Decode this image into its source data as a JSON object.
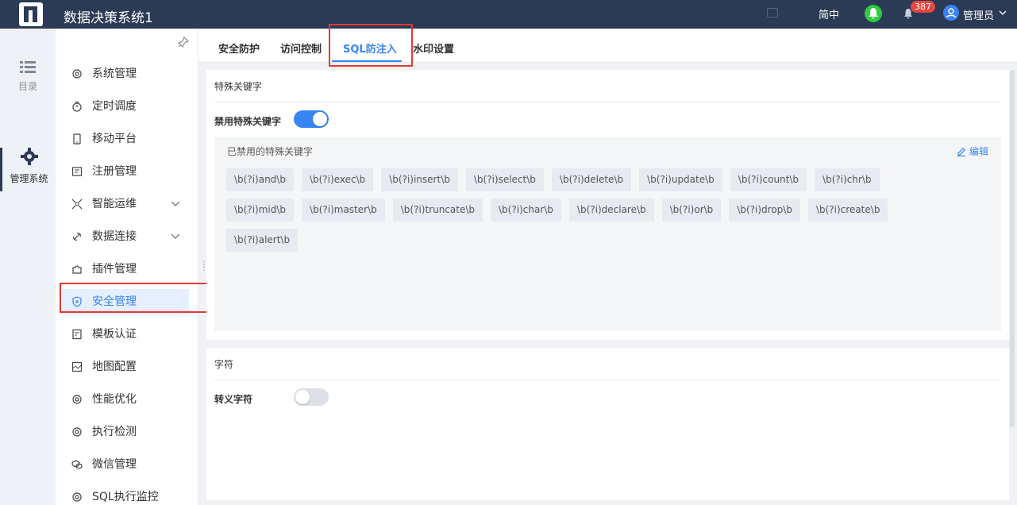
{
  "header": {
    "app_title": "数据决策系统1",
    "language": "简中",
    "notification_count": "387",
    "username": "管理员"
  },
  "rail": {
    "items": [
      {
        "label": "目录"
      },
      {
        "label": "管理系统"
      }
    ]
  },
  "sidebar": {
    "items": [
      {
        "label": "系统管理",
        "icon": "gear-icon"
      },
      {
        "label": "定时调度",
        "icon": "timer-icon"
      },
      {
        "label": "移动平台",
        "icon": "mobile-icon"
      },
      {
        "label": "注册管理",
        "icon": "register-icon"
      },
      {
        "label": "智能运维",
        "icon": "ops-icon",
        "expandable": true
      },
      {
        "label": "数据连接",
        "icon": "link-icon",
        "expandable": true
      },
      {
        "label": "插件管理",
        "icon": "plugin-icon"
      },
      {
        "label": "安全管理",
        "icon": "shield-icon",
        "active": true
      },
      {
        "label": "模板认证",
        "icon": "template-icon"
      },
      {
        "label": "地图配置",
        "icon": "map-icon"
      },
      {
        "label": "性能优化",
        "icon": "gear-icon"
      },
      {
        "label": "执行检测",
        "icon": "gear-icon"
      },
      {
        "label": "微信管理",
        "icon": "wechat-icon"
      },
      {
        "label": "SQL执行监控",
        "icon": "gear-icon"
      }
    ]
  },
  "tabs": [
    {
      "label": "安全防护"
    },
    {
      "label": "访问控制"
    },
    {
      "label": "SQL防注入",
      "active": true
    },
    {
      "label": "水印设置"
    }
  ],
  "special_keywords": {
    "section_title": "特殊关键字",
    "toggle_label": "禁用特殊关键字",
    "toggle_on": true,
    "box_title": "已禁用的特殊关键字",
    "edit_label": "编辑",
    "keywords": [
      "\\b(?i)and\\b",
      "\\b(?i)exec\\b",
      "\\b(?i)insert\\b",
      "\\b(?i)select\\b",
      "\\b(?i)delete\\b",
      "\\b(?i)update\\b",
      "\\b(?i)count\\b",
      "\\b(?i)chr\\b",
      "\\b(?i)mid\\b",
      "\\b(?i)master\\b",
      "\\b(?i)truncate\\b",
      "\\b(?i)char\\b",
      "\\b(?i)declare\\b",
      "\\b(?i)or\\b",
      "\\b(?i)drop\\b",
      "\\b(?i)create\\b",
      "\\b(?i)alert\\b"
    ]
  },
  "characters": {
    "section_title": "字符",
    "toggle_label": "转义字符",
    "toggle_on": false
  },
  "colors": {
    "header_bg": "#2b3a55",
    "accent": "#3685f2",
    "highlight_box": "#e53935",
    "badge": "#e9473f"
  }
}
